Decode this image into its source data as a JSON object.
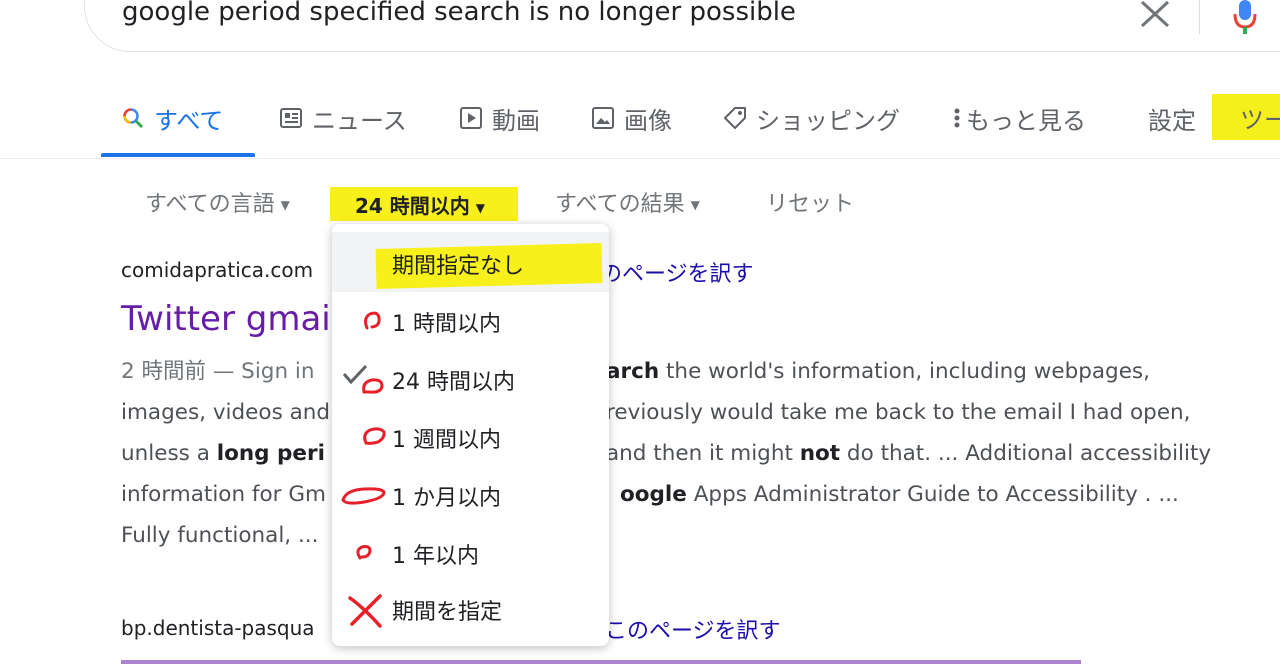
{
  "search": {
    "query": "google period specified search is no longer possible"
  },
  "tabs": [
    {
      "label": "すべて",
      "icon": "search-icon"
    },
    {
      "label": "ニュース",
      "icon": "news-icon"
    },
    {
      "label": "動画",
      "icon": "video-icon"
    },
    {
      "label": "画像",
      "icon": "image-icon"
    },
    {
      "label": "ショッピング",
      "icon": "tag-icon"
    },
    {
      "label": "もっと見る",
      "icon": "more-vert-icon"
    },
    {
      "label": "設定"
    },
    {
      "label": "ツー"
    }
  ],
  "filters": {
    "language": "すべての言語",
    "time": "24 時間以内",
    "results": "すべての結果",
    "reset": "リセット"
  },
  "time_menu": {
    "items": [
      {
        "label": "期間指定なし"
      },
      {
        "label": "1 時間以内"
      },
      {
        "label": "24 時間以内",
        "checked": true
      },
      {
        "label": "1 週間以内"
      },
      {
        "label": "1 か月以内"
      },
      {
        "label": "1 年以内"
      },
      {
        "label": "期間を指定"
      }
    ]
  },
  "results": [
    {
      "url": "comidapratica.com",
      "translate": "のページを訳す",
      "title": "Twitter gmail",
      "snippet_lines": [
        {
          "pre": "2 時間前 — Sign in",
          "gap": "",
          "bold": "arch",
          "post": " the world's information, including webpages,"
        },
        {
          "pre": "images, videos and",
          "post": "reviously would take me back to the email I had open,"
        },
        {
          "pre": "unless a ",
          "bold1": "long peri",
          "post": "and then it might ",
          "bold2": "not",
          "post2": " do that. ... Additional accessibility"
        },
        {
          "pre": "information for Gm",
          "bold": "oogle",
          "post": " Apps Administrator Guide to Accessibility . ..."
        },
        {
          "pre": "Fully functional, ..."
        }
      ]
    },
    {
      "url": "bp.dentista-pasqua",
      "translate": "このページを訳す"
    }
  ],
  "colors": {
    "accent": "#1a73e8",
    "visited_title": "#681da8",
    "highlight": "#f8f01a",
    "annotation_red": "#e8202a"
  }
}
